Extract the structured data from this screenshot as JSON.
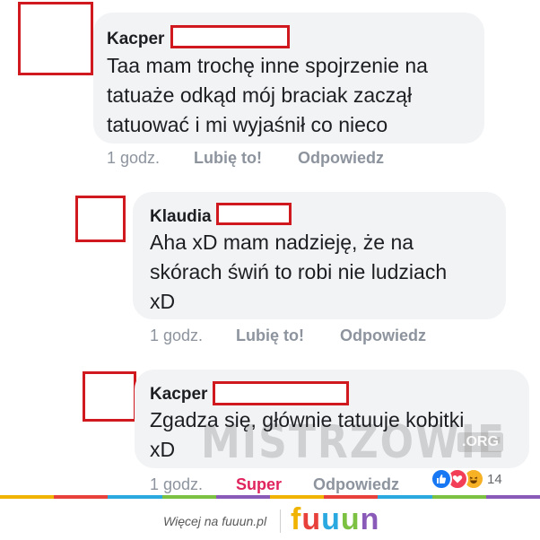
{
  "comments": [
    {
      "author": "Kacper",
      "text_lines": [
        "Taa mam trochę inne spojrzenie na",
        "tatuaże odkąd mój braciak zaczął",
        "tatuować i mi wyjaśnił co nieco"
      ],
      "time": "1 godz.",
      "like_label": "Lubię to!",
      "reply_label": "Odpowiedz"
    },
    {
      "author": "Klaudia",
      "text_lines": [
        "Aha xD mam nadzieję, że na",
        "skórach świń to robi nie ludziach",
        "xD"
      ],
      "time": "1 godz.",
      "like_label": "Lubię to!",
      "reply_label": "Odpowiedz"
    },
    {
      "author": "Kacper",
      "text_lines": [
        "Zgadza się, głównie tatuuje kobitki",
        "xD"
      ],
      "time": "1 godz.",
      "like_label": "Super",
      "reply_label": "Odpowiedz",
      "reaction_count": "14",
      "reaction_icons": [
        "like-icon",
        "love-icon",
        "haha-icon"
      ]
    }
  ],
  "watermark": {
    "text": "MISTRZOWIE",
    "suffix": ".ORG"
  },
  "footer": {
    "link_text": "Więcej na fuuun.pl",
    "logo_letters": [
      "f",
      "u",
      "u",
      "u",
      "n"
    ]
  },
  "colors": {
    "redaction": "#d0181f",
    "bubble": "#f2f3f5",
    "super": "#e0245e",
    "bar": [
      "#f0b400",
      "#e8413c",
      "#2aa8e0",
      "#7cc142",
      "#8a5ab8",
      "#f0b400",
      "#e8413c",
      "#2aa8e0",
      "#7cc142",
      "#8a5ab8"
    ]
  }
}
